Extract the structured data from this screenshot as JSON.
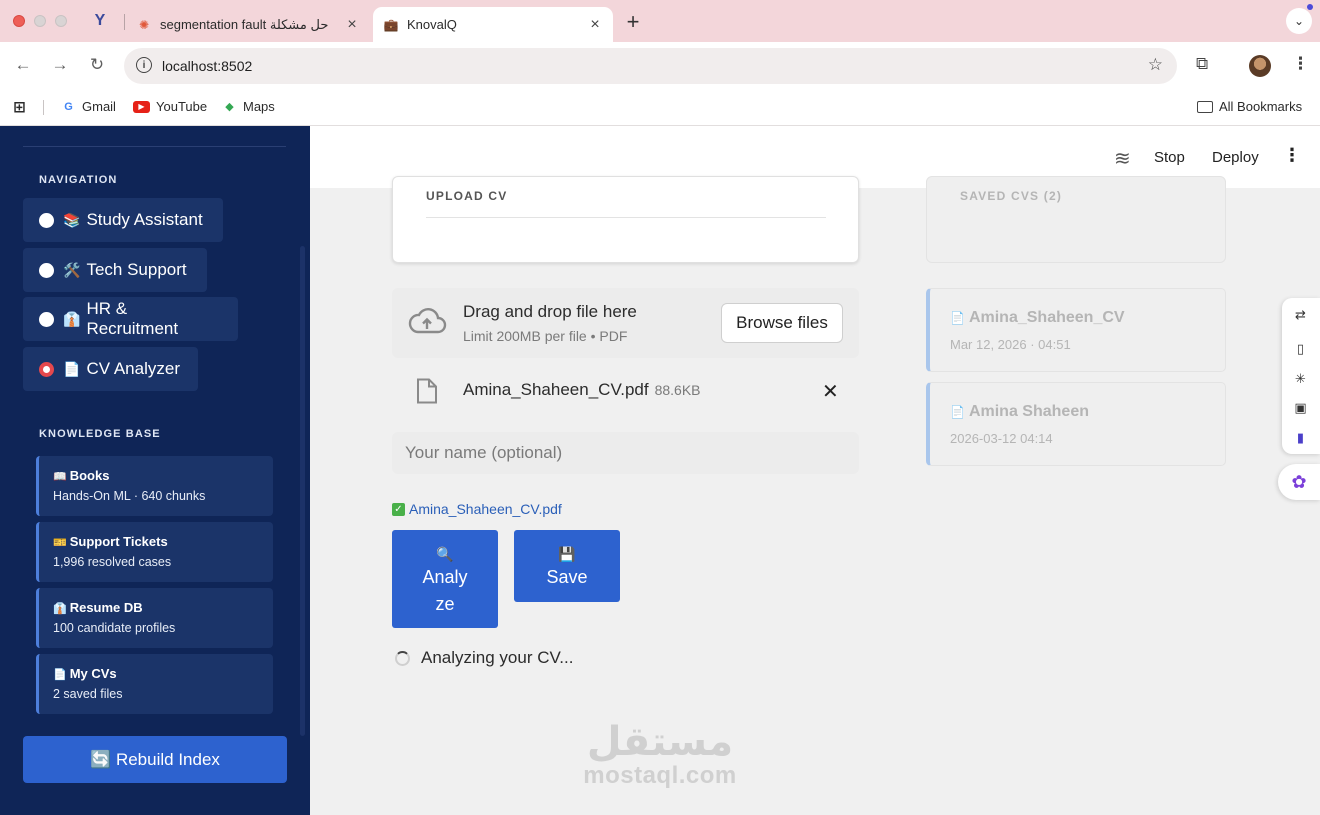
{
  "browser": {
    "tabs": [
      {
        "title": "حل مشكلة segmentation fault",
        "active": false
      },
      {
        "title": "KnovalQ",
        "active": true
      }
    ],
    "url": "localhost:8502",
    "bookmarks": [
      "Gmail",
      "YouTube",
      "Maps"
    ],
    "all_bookmarks": "All Bookmarks"
  },
  "header": {
    "stop": "Stop",
    "deploy": "Deploy"
  },
  "sidebar": {
    "nav_heading": "NAVIGATION",
    "nav_items": [
      {
        "emoji": "📚",
        "label": "Study Assistant",
        "selected": false
      },
      {
        "emoji": "🛠️",
        "label": "Tech Support",
        "selected": false
      },
      {
        "emoji": "👔",
        "label": "HR & Recruitment",
        "selected": false
      },
      {
        "emoji": "📄",
        "label": "CV Analyzer",
        "selected": true
      }
    ],
    "kb_heading": "KNOWLEDGE BASE",
    "kb_items": [
      {
        "emoji": "📖",
        "title": "Books",
        "subtitle": "Hands-On ML · 640 chunks"
      },
      {
        "emoji": "🎫",
        "title": "Support Tickets",
        "subtitle": "1,996 resolved cases"
      },
      {
        "emoji": "👔",
        "title": "Resume DB",
        "subtitle": "100 candidate profiles"
      },
      {
        "emoji": "📄",
        "title": "My CVs",
        "subtitle": "2 saved files"
      }
    ],
    "rebuild": "🔄 Rebuild Index"
  },
  "main": {
    "upload_label": "UPLOAD CV",
    "saved_label": "SAVED CVS (2)",
    "dropzone": {
      "title": "Drag and drop file here",
      "limit": "Limit 200MB per file • PDF",
      "browse": "Browse files"
    },
    "file": {
      "name": "Amina_Shaheen_CV.pdf",
      "size": "88.6KB"
    },
    "name_placeholder": "Your name (optional)",
    "uploaded_ok": "Amina_Shaheen_CV.pdf",
    "analyze_icon": "🔍",
    "analyze_l1": "Analy",
    "analyze_l2": "ze",
    "save_icon": "💾",
    "save": "Save",
    "status": "Analyzing your CV...",
    "saved_cvs": [
      {
        "name": "Amina_Shaheen_CV",
        "date": "Mar 12, 2026 · 04:51"
      },
      {
        "name": "Amina Shaheen",
        "date": "2026-03-12 04:14"
      }
    ]
  },
  "watermark": {
    "ar": "مستقل",
    "en": "mostaql.com"
  }
}
